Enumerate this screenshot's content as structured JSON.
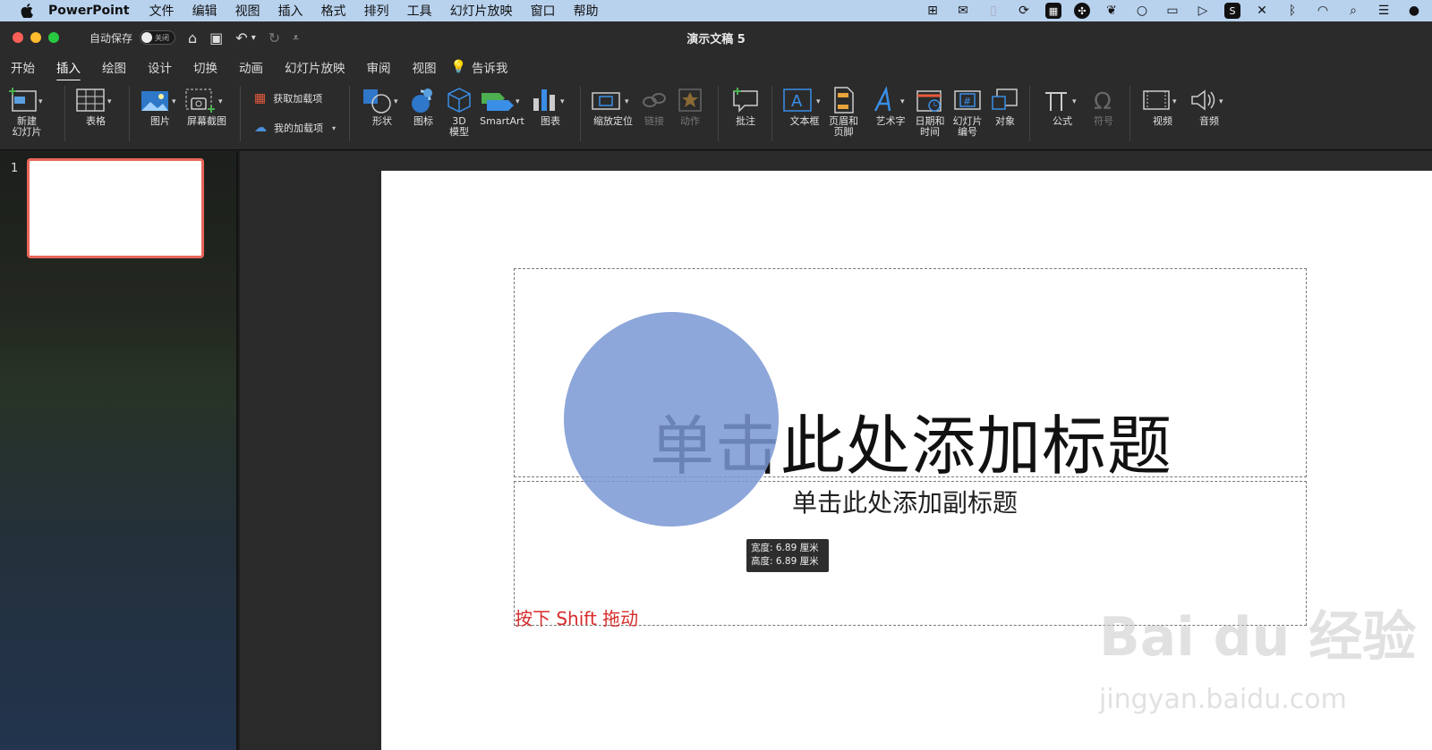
{
  "menubar": {
    "app": "PowerPoint",
    "items": [
      "文件",
      "编辑",
      "视图",
      "插入",
      "格式",
      "排列",
      "工具",
      "幻灯片放映",
      "窗口",
      "帮助"
    ]
  },
  "titlebar": {
    "autosave": "自动保存",
    "toggle": "关闭",
    "title": "演示文稿 5"
  },
  "tabs": {
    "items": [
      "开始",
      "插入",
      "绘图",
      "设计",
      "切换",
      "动画",
      "幻灯片放映",
      "审阅",
      "视图"
    ],
    "tell_me": "告诉我"
  },
  "ribbon": {
    "new_slide": "新建\n幻灯片",
    "table": "表格",
    "picture": "图片",
    "screenshot": "屏幕截图",
    "get_addins": "获取加载项",
    "my_addins": "我的加载项",
    "shapes": "形状",
    "icons": "图标",
    "model_3d": "3D\n模型",
    "smartart": "SmartArt",
    "chart": "图表",
    "zoom": "缩放定位",
    "link": "链接",
    "action": "动作",
    "comment": "批注",
    "textbox": "文本框",
    "header_footer": "页眉和\n页脚",
    "wordart": "艺术字",
    "datetime": "日期和\n时间",
    "slide_number": "幻灯片\n编号",
    "object": "对象",
    "equation": "公式",
    "symbol": "符号",
    "video": "视频",
    "audio": "音频"
  },
  "sidebar": {
    "slide_number": "1"
  },
  "slide": {
    "title": "单击此处添加标题",
    "subtitle": "单击此处添加副标题",
    "tooltip_width": "宽度: 6.89 厘米",
    "tooltip_height": "高度: 6.89 厘米",
    "note": "按下 Shift 拖动",
    "watermark": "Bai du 经验",
    "watermark_url": "jingyan.baidu.com"
  },
  "colors": {
    "accent_tab": "#ffffff",
    "circle_fill": "#7a98d4",
    "note_red": "#d62d2d",
    "thumb_border": "#e8665a",
    "menubar_bg": "#b8d2ee"
  }
}
